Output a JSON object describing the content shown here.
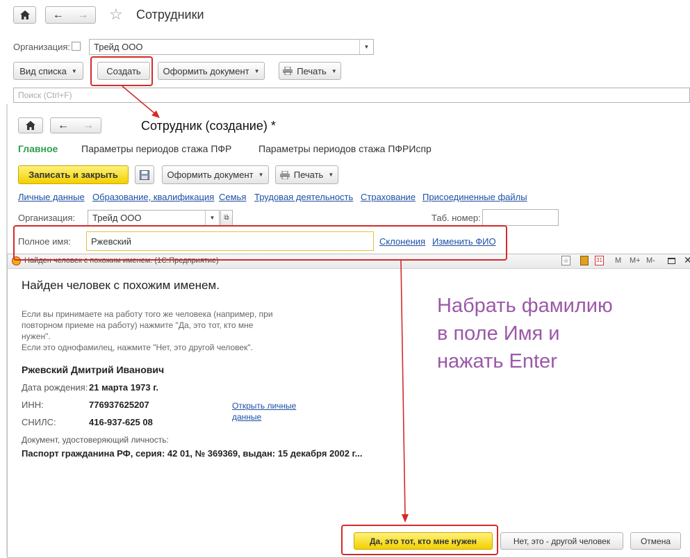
{
  "main_window": {
    "title": "Сотрудники",
    "organization_label": "Организация:",
    "organization_value": "Трейд ООО",
    "buttons": {
      "view_list": "Вид списка",
      "create": "Создать",
      "make_document": "Оформить документ",
      "print": "Печать"
    },
    "search_placeholder": "Поиск (Ctrl+F)"
  },
  "employee_form": {
    "title": "Сотрудник (создание) *",
    "tabs": [
      "Главное",
      "Параметры периодов стажа ПФР",
      "Параметры периодов стажа ПФРИспр"
    ],
    "buttons": {
      "save_close": "Записать и закрыть",
      "make_document": "Оформить документ",
      "print": "Печать"
    },
    "links": [
      "Личные данные",
      "Образование, квалификация",
      "Семья",
      "Трудовая деятельность",
      "Страхование",
      "Присоединенные файлы"
    ],
    "organization_label": "Организация:",
    "organization_value": "Трейд ООО",
    "tab_number_label": "Таб. номер:",
    "full_name_label": "Полное имя:",
    "full_name_value": "Ржевский",
    "declensions_link": "Склонения",
    "change_name_link": "Изменить ФИО"
  },
  "dialog": {
    "title": "Найден человек с похожим именем.  (1С:Предприятие)",
    "heading": "Найден человек с похожим именем.",
    "hint_lines": [
      "Если вы принимаете на работу того же человека (например, при",
      "повторном приеме на работу) нажмите \"Да, это тот, кто мне",
      "нужен\".",
      "Если это однофамилец, нажмите \"Нет, это другой человек\"."
    ],
    "person_name": "Ржевский Дмитрий Иванович",
    "birth_label": "Дата рождения:",
    "birth_value": "21 марта 1973 г.",
    "inn_label": "ИНН:",
    "inn_value": "776937625207",
    "snils_label": "СНИЛС:",
    "snils_value": "416-937-625 08",
    "open_personal_link_1": "Открыть личные",
    "open_personal_link_2": "данные",
    "doc_label": "Документ, удостоверяющий личность:",
    "doc_value": "Паспорт гражданина РФ, серия: 42 01, № 369369, выдан: 15 декабря 2002 г...",
    "buttons": {
      "yes": "Да, это тот, кто мне нужен",
      "no": "Нет, это - другой человек",
      "cancel": "Отмена"
    },
    "title_controls": [
      "M",
      "M+",
      "M-"
    ]
  },
  "annotation": {
    "lines": [
      "Набрать фамилию",
      "в поле Имя и",
      "нажать Enter"
    ],
    "color": "#9b59a8"
  }
}
